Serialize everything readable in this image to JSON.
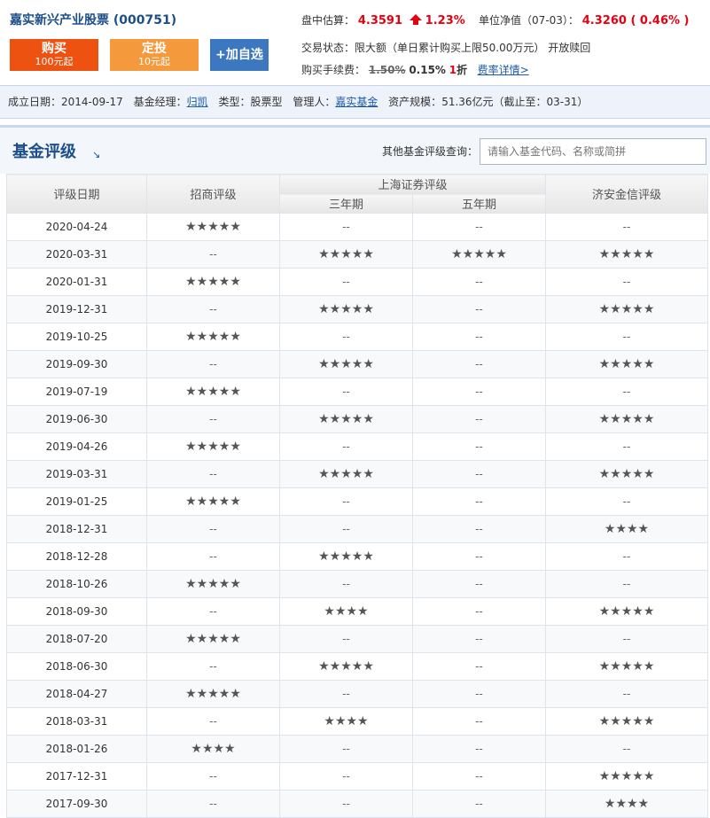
{
  "header": {
    "fund_name": "嘉实新兴产业股票 (000751)",
    "buy": {
      "label": "购买",
      "sub": "100元起"
    },
    "sip": {
      "label": "定投",
      "sub": "10元起"
    },
    "add_fav": "+加自选",
    "estimate_label": "盘中估算：",
    "estimate_value": "4.3591",
    "estimate_change": "1.23%",
    "nav_label": "单位净值（07-03）：",
    "nav_value": "4.3260 ( 0.46% )",
    "status_label": "交易状态：",
    "status_value": "限大额",
    "status_detail": "（单日累计购买上限50.00万元）",
    "status_open": "开放赎回",
    "fee_label": "购买手续费：",
    "fee_original": "1.50%",
    "fee_current": "0.15%",
    "discount": "1",
    "discount_unit": "折",
    "fee_link": "费率详情>"
  },
  "info": {
    "founded_label": "成立日期：",
    "founded": "2014-09-17",
    "manager_label": "基金经理：",
    "manager": "归凯",
    "type_label": "类型：",
    "type": "股票型",
    "company_label": "管理人：",
    "company": "嘉实基金",
    "size_label": "资产规模：",
    "size": "51.36亿元（截止至：03-31）"
  },
  "section": {
    "title": "基金评级",
    "title_icon": "↘",
    "query_label": "其他基金评级查询：",
    "query_placeholder": "请输入基金代码、名称或简拼"
  },
  "table": {
    "headers": {
      "date": "评级日期",
      "zs": "招商评级",
      "sh": "上海证券评级",
      "sh3": "三年期",
      "sh5": "五年期",
      "ja": "济安金信评级"
    },
    "rows": [
      {
        "date": "2020-04-24",
        "zs": 5,
        "sh3": 0,
        "sh5": 0,
        "ja": 0
      },
      {
        "date": "2020-03-31",
        "zs": 0,
        "sh3": 5,
        "sh5": 5,
        "ja": 5
      },
      {
        "date": "2020-01-31",
        "zs": 5,
        "sh3": 0,
        "sh5": 0,
        "ja": 0
      },
      {
        "date": "2019-12-31",
        "zs": 0,
        "sh3": 5,
        "sh5": 0,
        "ja": 5
      },
      {
        "date": "2019-10-25",
        "zs": 5,
        "sh3": 0,
        "sh5": 0,
        "ja": 0
      },
      {
        "date": "2019-09-30",
        "zs": 0,
        "sh3": 5,
        "sh5": 0,
        "ja": 5
      },
      {
        "date": "2019-07-19",
        "zs": 5,
        "sh3": 0,
        "sh5": 0,
        "ja": 0
      },
      {
        "date": "2019-06-30",
        "zs": 0,
        "sh3": 5,
        "sh5": 0,
        "ja": 5
      },
      {
        "date": "2019-04-26",
        "zs": 5,
        "sh3": 0,
        "sh5": 0,
        "ja": 0
      },
      {
        "date": "2019-03-31",
        "zs": 0,
        "sh3": 5,
        "sh5": 0,
        "ja": 5
      },
      {
        "date": "2019-01-25",
        "zs": 5,
        "sh3": 0,
        "sh5": 0,
        "ja": 0
      },
      {
        "date": "2018-12-31",
        "zs": 0,
        "sh3": 0,
        "sh5": 0,
        "ja": 4
      },
      {
        "date": "2018-12-28",
        "zs": 0,
        "sh3": 5,
        "sh5": 0,
        "ja": 0
      },
      {
        "date": "2018-10-26",
        "zs": 5,
        "sh3": 0,
        "sh5": 0,
        "ja": 0
      },
      {
        "date": "2018-09-30",
        "zs": 0,
        "sh3": 4,
        "sh5": 0,
        "ja": 5
      },
      {
        "date": "2018-07-20",
        "zs": 5,
        "sh3": 0,
        "sh5": 0,
        "ja": 0
      },
      {
        "date": "2018-06-30",
        "zs": 0,
        "sh3": 5,
        "sh5": 0,
        "ja": 5
      },
      {
        "date": "2018-04-27",
        "zs": 5,
        "sh3": 0,
        "sh5": 0,
        "ja": 0
      },
      {
        "date": "2018-03-31",
        "zs": 0,
        "sh3": 4,
        "sh5": 0,
        "ja": 5
      },
      {
        "date": "2018-01-26",
        "zs": 4,
        "sh3": 0,
        "sh5": 0,
        "ja": 0
      },
      {
        "date": "2017-12-31",
        "zs": 0,
        "sh3": 0,
        "sh5": 0,
        "ja": 5
      },
      {
        "date": "2017-09-30",
        "zs": 0,
        "sh3": 0,
        "sh5": 0,
        "ja": 4
      }
    ],
    "empty_mark": "--",
    "star_glyph": "★"
  },
  "colors": {
    "accent_red": "#e60012",
    "buy": "#ee5211",
    "sip": "#f49a3c",
    "fav": "#3c78c0",
    "title_blue": "#1c4e8a"
  }
}
